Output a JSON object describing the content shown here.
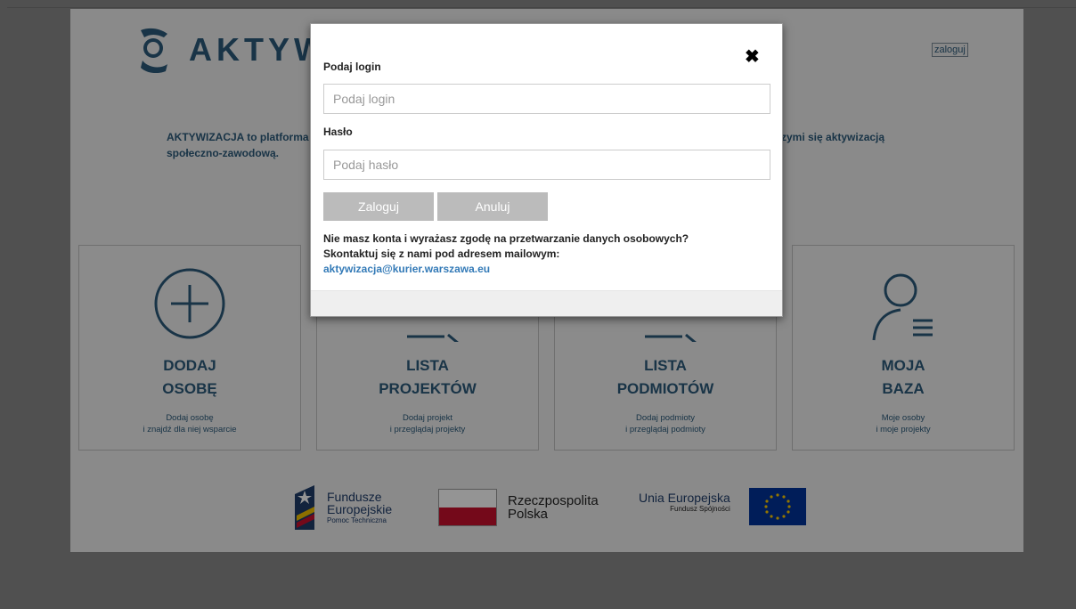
{
  "header": {
    "logo_text": "AKTYWIZACJA",
    "login_link": "zaloguj"
  },
  "intro": {
    "left_line_1": "AKTYWIZACJA to platforma",
    "left_line_2": "społeczno-zawodową.",
    "right_line_1": "zymi się aktywizacją"
  },
  "tiles": [
    {
      "title_1": "DODAJ",
      "title_2": "OSOBĘ",
      "sub_1": "Dodaj osobę",
      "sub_2": "i znajdź dla niej wsparcie",
      "icon": "plus-circle-icon"
    },
    {
      "title_1": "LISTA",
      "title_2": "PROJEKTÓW",
      "sub_1": "Dodaj projekt",
      "sub_2": "i przeglądaj projekty",
      "icon": "search-list-icon"
    },
    {
      "title_1": "LISTA",
      "title_2": "PODMIOTÓW",
      "sub_1": "Dodaj podmioty",
      "sub_2": "i przeglądaj podmioty",
      "icon": "search-list-icon"
    },
    {
      "title_1": "MOJA",
      "title_2": "BAZA",
      "sub_1": "Moje osoby",
      "sub_2": "i moje projekty",
      "icon": "user-list-icon"
    }
  ],
  "footer_logos": {
    "fe_line_1": "Fundusze",
    "fe_line_2": "Europejskie",
    "fe_line_3": "Pomoc Techniczna",
    "rp_line_1": "Rzeczpospolita",
    "rp_line_2": "Polska",
    "ue_line_1": "Unia Europejska",
    "ue_line_2": "Fundusz Spójności"
  },
  "modal": {
    "login_label": "Podaj login",
    "login_placeholder": "Podaj login",
    "password_label": "Hasło",
    "password_placeholder": "Podaj hasło",
    "login_button": "Zaloguj",
    "cancel_button": "Anuluj",
    "note_line_1": "Nie masz konta i wyrażasz zgodę na przetwarzanie danych osobowych?",
    "note_line_2": "Skontaktuj się z nami pod adresem mailowym:",
    "email": "aktywizacja@kurier.warszawa.eu",
    "close_glyph": "✖"
  },
  "colors": {
    "brand": "#2b5a7a",
    "button_gray": "#bbbbbb",
    "link": "#337ab7"
  }
}
